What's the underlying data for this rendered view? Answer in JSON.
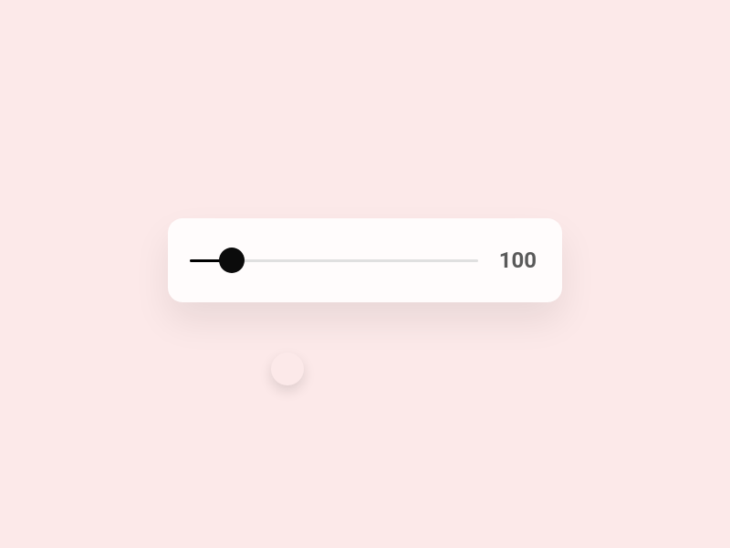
{
  "slider": {
    "value_display": "100",
    "min": 0,
    "max": 1000,
    "current_position_percent": 10
  },
  "colors": {
    "background": "#fce9e9",
    "card": "#fffcfc",
    "thumb": "#0b0b0b",
    "track": "#e0e0e0",
    "text": "#5a5a5a"
  }
}
